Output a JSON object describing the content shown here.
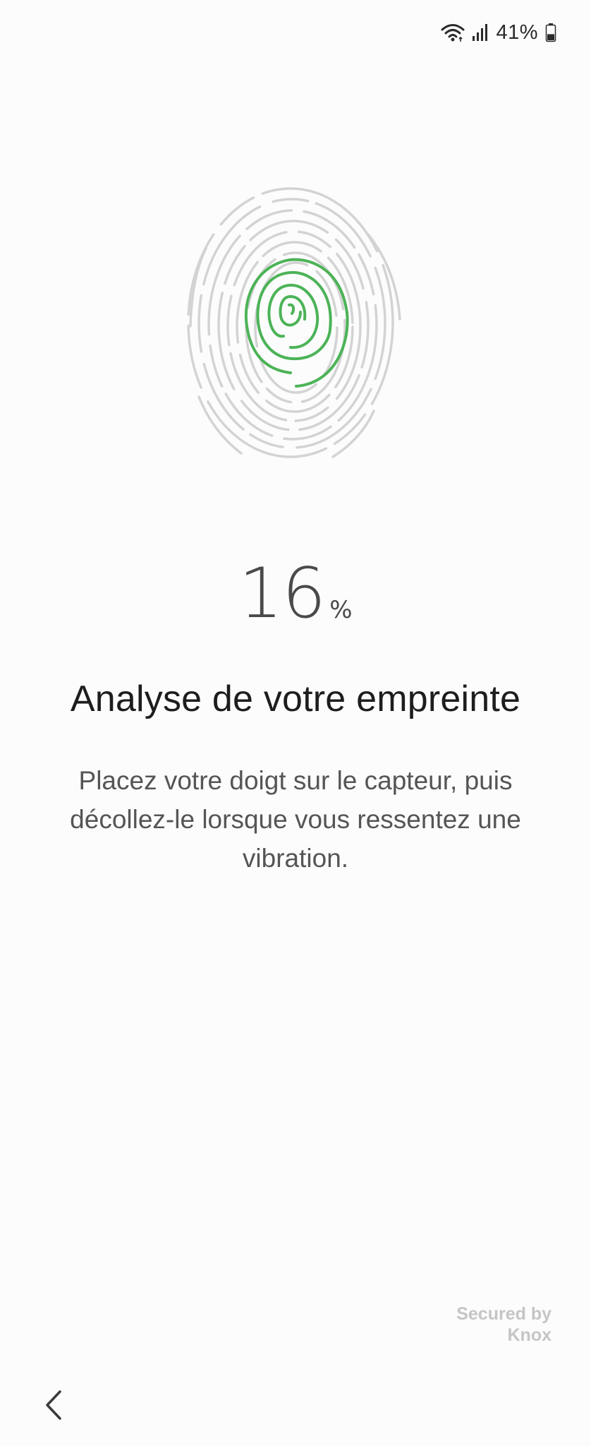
{
  "status_bar": {
    "battery_percent": "41%",
    "icons": [
      "wifi-icon",
      "signal-icon",
      "battery-icon"
    ],
    "battery_level": 0.41
  },
  "fingerprint": {
    "icon": "fingerprint-icon",
    "progress_color": "#4cb357",
    "base_color": "#d3d3d3"
  },
  "progress": {
    "value": "16",
    "unit": "%"
  },
  "title": "Analyse de votre empreinte",
  "instructions": "Placez votre doigt sur le capteur, puis décollez-le lorsque vous ressentez une vibration.",
  "knox": {
    "line1": "Secured by",
    "line2": "Knox"
  },
  "navigation": {
    "back_icon": "chevron-left-icon"
  }
}
